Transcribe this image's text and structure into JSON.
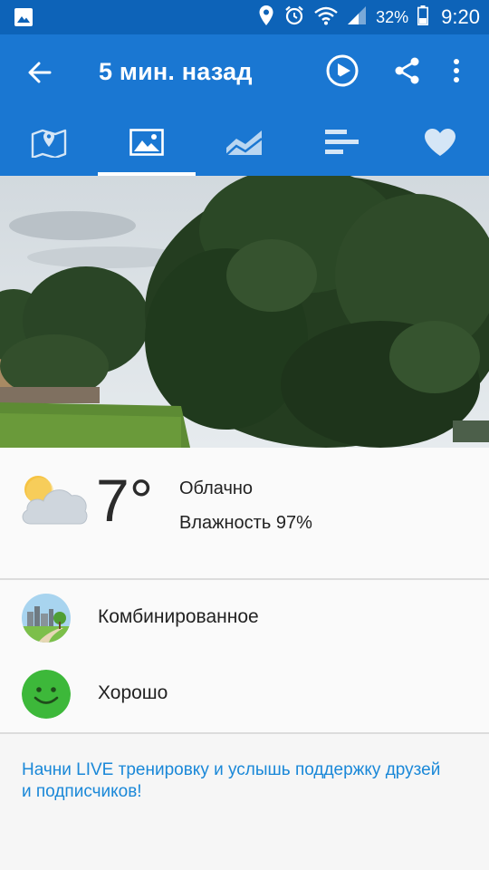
{
  "status_bar": {
    "battery": "32%",
    "time": "9:20",
    "icons": [
      "gallery-icon",
      "location-icon",
      "alarm-icon",
      "wifi-icon",
      "signal-icon",
      "battery-icon"
    ]
  },
  "app_bar": {
    "title": "5 мин. назад",
    "icons": [
      "back-arrow-icon",
      "route-play-icon",
      "share-icon",
      "more-icon"
    ]
  },
  "tabs": [
    {
      "name": "map",
      "icon": "map-icon"
    },
    {
      "name": "photo",
      "icon": "image-icon",
      "active": true
    },
    {
      "name": "chart",
      "icon": "chart-icon"
    },
    {
      "name": "splits",
      "icon": "bars-icon"
    },
    {
      "name": "like",
      "icon": "heart-icon"
    }
  ],
  "weather": {
    "temperature": "7°",
    "condition": "Облачно",
    "humidity": "Влажность 97%",
    "icon": "partly-cloudy-icon"
  },
  "surface": {
    "label": "Комбинированное",
    "icon": "mixed-terrain-icon"
  },
  "feeling": {
    "label": "Хорошо",
    "icon": "smiley-icon"
  },
  "live_prompt": "Начни LIVE тренировку и услышь поддержку друзей и подписчиков!",
  "colors": {
    "status_bar": "#0d63b8",
    "app_bar": "#1a77d2",
    "link": "#1a88d8",
    "smiley": "#3db83a"
  }
}
